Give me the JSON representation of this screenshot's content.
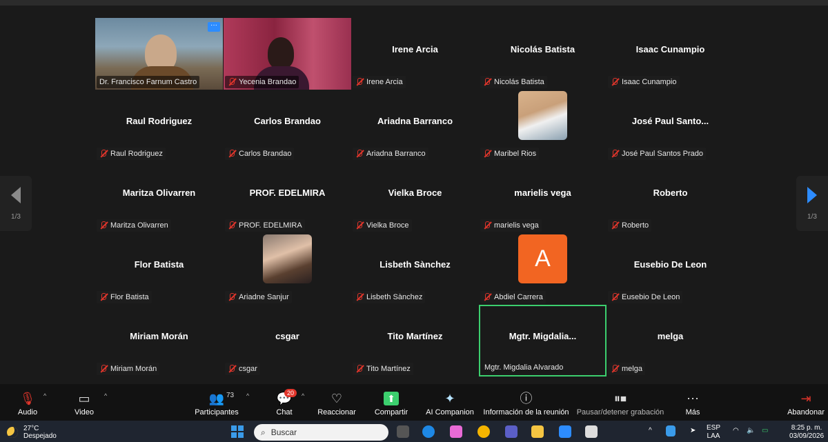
{
  "pagination": {
    "left": "1/3",
    "right": "1/3"
  },
  "video_tiles": [
    {
      "name": "Dr. Francisco Farnum Castro"
    },
    {
      "name": "Yecenia Brandao"
    }
  ],
  "participants": [
    {
      "center": "Irene Arcia",
      "label": "Irene Arcia"
    },
    {
      "center": "Nicolás Batista",
      "label": "Nicolás Batista"
    },
    {
      "center": "Isaac Cunampio",
      "label": "Isaac Cunampio"
    },
    {
      "center": "Raul Rodriguez",
      "label": "Raul Rodriguez"
    },
    {
      "center": "Carlos Brandao",
      "label": "Carlos Brandao"
    },
    {
      "center": "Ariadna Barranco",
      "label": "Ariadna Barranco"
    },
    {
      "center": "",
      "label": "Maribel Rios"
    },
    {
      "center": "José Paul Santo...",
      "label": "José Paul Santos Prado"
    },
    {
      "center": "Maritza Olivarren",
      "label": "Maritza Olivarren"
    },
    {
      "center": "PROF. EDELMIRA",
      "label": "PROF. EDELMIRA"
    },
    {
      "center": "Vielka Broce",
      "label": "Vielka Broce"
    },
    {
      "center": "marielis vega",
      "label": "marielis vega"
    },
    {
      "center": "Roberto",
      "label": "Roberto"
    },
    {
      "center": "Flor Batista",
      "label": "Flor Batista"
    },
    {
      "center": "",
      "label": "Ariadne Sanjur"
    },
    {
      "center": "Lisbeth Sànchez",
      "label": "Lisbeth Sànchez"
    },
    {
      "center": "A",
      "label": "Abdiel Carrera"
    },
    {
      "center": "Eusebio De Leon",
      "label": "Eusebio De Leon"
    },
    {
      "center": "Miriam Morán",
      "label": "Miriam Morán"
    },
    {
      "center": "csgar",
      "label": "csgar"
    },
    {
      "center": "Tito  Martínez",
      "label": "Tito  Martínez"
    },
    {
      "center": "Mgtr.  Migdalia...",
      "label": "Mgtr. Migdalia Alvarado"
    },
    {
      "center": "melga",
      "label": "melga"
    }
  ],
  "toolbar": {
    "audio": "Audio",
    "video": "Video",
    "participants": "Participantes",
    "participants_count": "73",
    "chat": "Chat",
    "chat_badge": "20",
    "react": "Reaccionar",
    "share": "Compartir",
    "ai": "AI Companion",
    "info": "Información de la reunión",
    "record": "Pausar/detener grabación",
    "more": "Más",
    "leave": "Abandonar"
  },
  "taskbar": {
    "temp": "27°C",
    "weather": "Despejado",
    "search_placeholder": "Buscar",
    "lang1": "ESP",
    "lang2": "LAA",
    "time": "8:25 p. m.",
    "date": "03/09/2026"
  },
  "colors": {
    "accent": "#2d8cff",
    "active_border": "#3ccf6e",
    "mute_red": "#e0352b",
    "avatar_orange": "#f26522"
  }
}
